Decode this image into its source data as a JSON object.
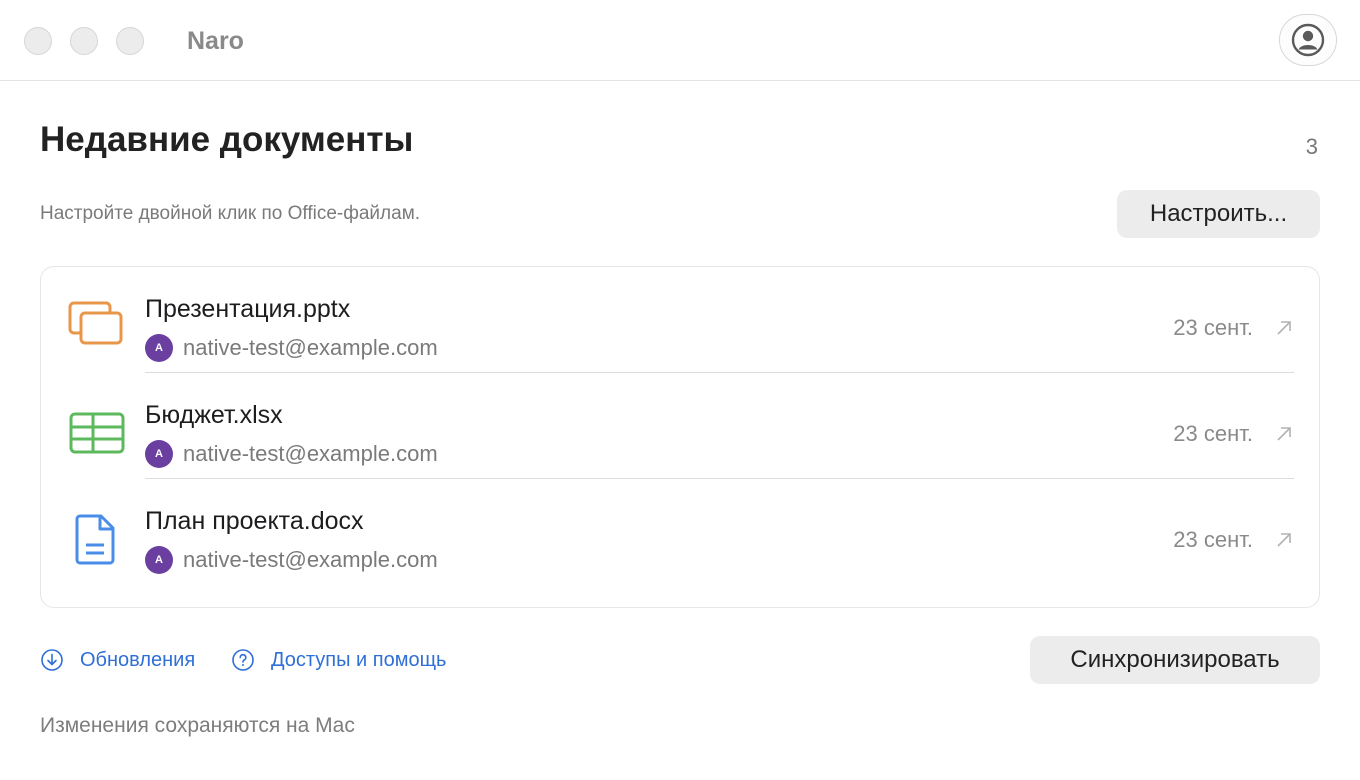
{
  "app": {
    "title": "Naro"
  },
  "header": {
    "title": "Недавние документы",
    "count": "3",
    "subtitle": "Настройте двойной клик по Office-файлам.",
    "configure_label": "Настроить..."
  },
  "documents": [
    {
      "name": "Презентация.pptx",
      "icon": "presentation-icon",
      "avatar": "A",
      "owner": "native-test@example.com",
      "date": "23 сент."
    },
    {
      "name": "Бюджет.xlsx",
      "icon": "spreadsheet-icon",
      "avatar": "A",
      "owner": "native-test@example.com",
      "date": "23 сент."
    },
    {
      "name": "План проекта.docx",
      "icon": "document-icon",
      "avatar": "A",
      "owner": "native-test@example.com",
      "date": "23 сент."
    }
  ],
  "footer": {
    "updates_label": "Обновления",
    "help_label": "Доступы и помощь",
    "sync_label": "Синхронизировать",
    "note": "Изменения сохраняются на Mac"
  },
  "colors": {
    "accent": "#2f6fd6",
    "pptx": "#e8974a",
    "xlsx": "#5cba5c",
    "docx": "#4a8de8",
    "avatar": "#6b3fa0"
  }
}
